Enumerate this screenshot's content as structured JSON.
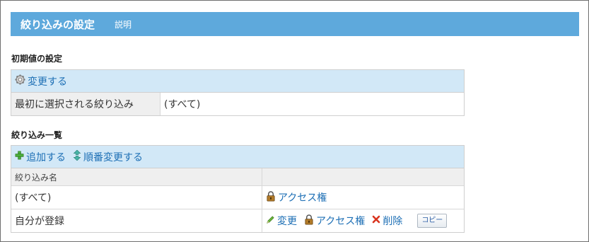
{
  "header": {
    "title": "絞り込みの設定",
    "help_label": "説明"
  },
  "defaults_section": {
    "label": "初期値の設定",
    "change_label": "変更する",
    "row_label": "最初に選択される絞り込み",
    "row_value": "(すべて)"
  },
  "list_section": {
    "label": "絞り込み一覧",
    "add_label": "追加する",
    "reorder_label": "順番変更する",
    "column_name": "絞り込み名",
    "column_actions": "",
    "rows": [
      {
        "name": "(すべて)",
        "access_label": "アクセス権"
      },
      {
        "name": "自分が登録",
        "edit_label": "変更",
        "access_label": "アクセス権",
        "delete_label": "削除",
        "copy_label": "コピー"
      }
    ]
  },
  "colors": {
    "header_bg": "#5ea9dc",
    "toolbar_bg": "#d2e8f7",
    "link": "#1d6fb5",
    "delete_icon": "#d9341f"
  }
}
